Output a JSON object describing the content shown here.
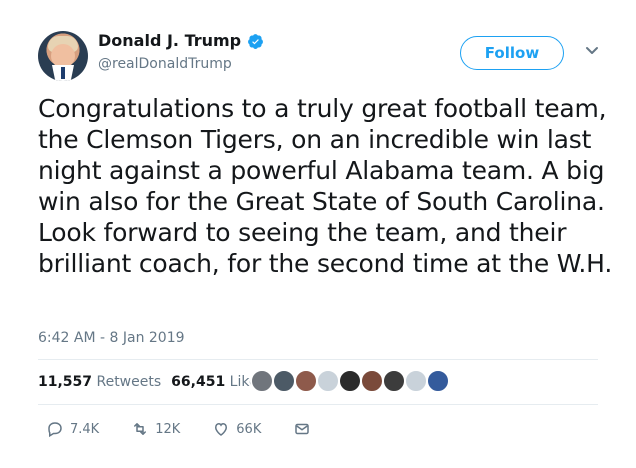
{
  "profile": {
    "name": "Donald J. Trump",
    "handle": "@realDonaldTrump",
    "verified": true,
    "follow_label": "Follow"
  },
  "tweet": {
    "text": "Congratulations to a truly great football team, the Clemson Tigers, on an incredible win last night against a powerful Alabama team. A big win also for the Great State of South Carolina. Look forward to seeing the team, and their brilliant coach, for the second time at the W.H.",
    "timestamp": "6:42 AM - 8 Jan 2019"
  },
  "stats": {
    "retweets_count": "11,557",
    "retweets_label": "Retweets",
    "likes_count": "66,451",
    "likes_label": "Likes"
  },
  "likers": {
    "colors": [
      "#70757c",
      "#4c5a66",
      "#8e5a4b",
      "#c9d2da",
      "#2b2b2b",
      "#7a4a3a",
      "#3c3c3c",
      "#c9d2da",
      "#345b9c"
    ]
  },
  "actions": {
    "reply_count": "7.4K",
    "retweet_count": "12K",
    "like_count": "66K"
  },
  "colors": {
    "accent": "#1da1f2",
    "muted_text": "#657786",
    "divider": "#e6ecf0"
  }
}
